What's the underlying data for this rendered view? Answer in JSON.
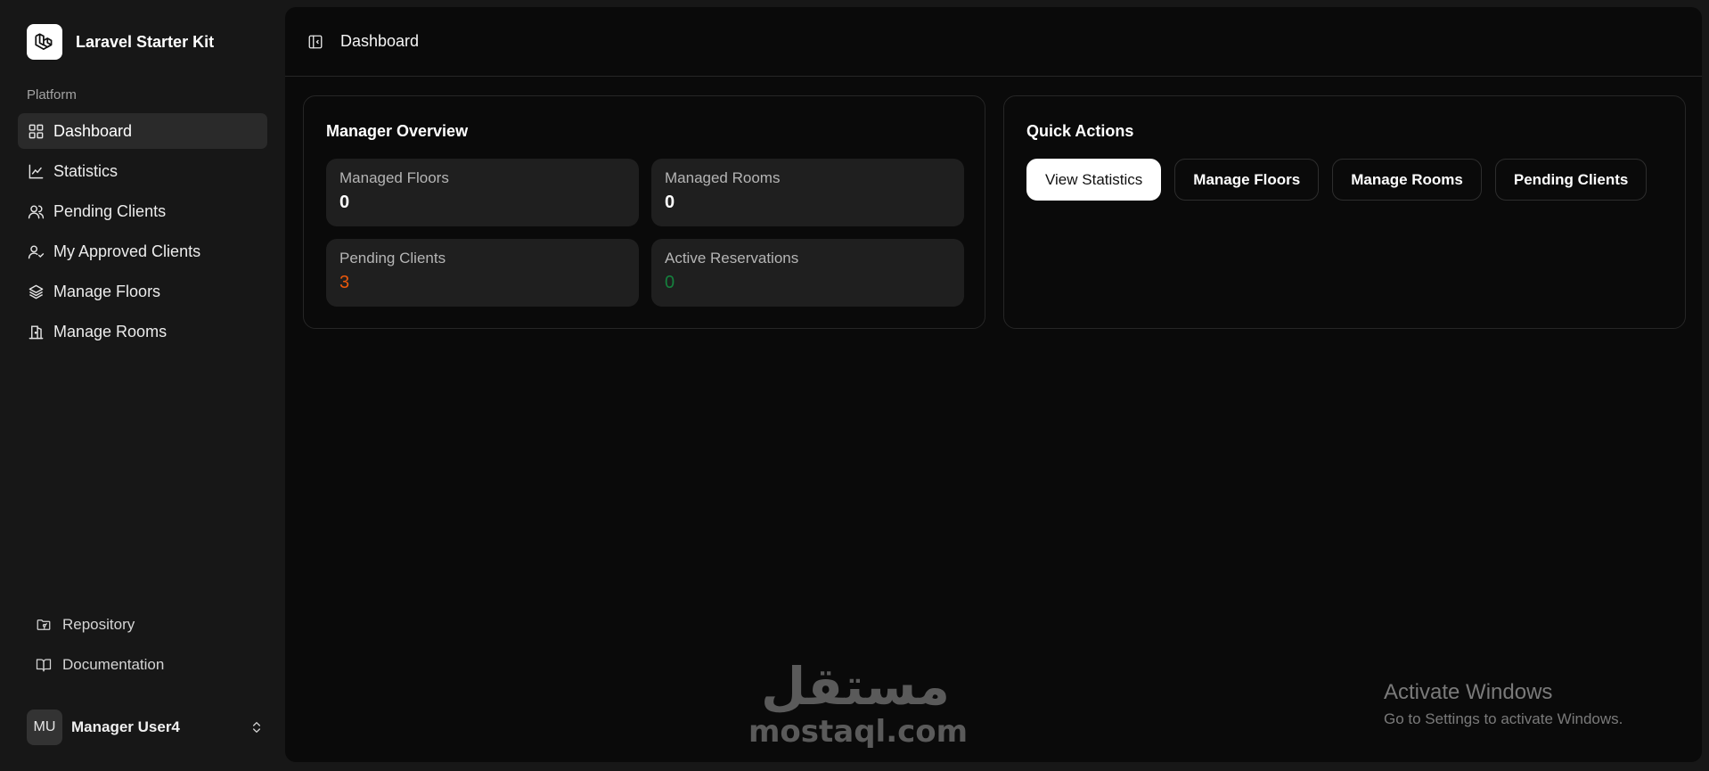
{
  "brand": {
    "title": "Laravel Starter Kit",
    "logo_icon": "laravel-logo-icon"
  },
  "sidebar": {
    "group_label": "Platform",
    "items": [
      {
        "label": "Dashboard",
        "icon": "grid-icon",
        "active": true
      },
      {
        "label": "Statistics",
        "icon": "chart-icon",
        "active": false
      },
      {
        "label": "Pending Clients",
        "icon": "users-icon",
        "active": false
      },
      {
        "label": "My Approved Clients",
        "icon": "user-check-icon",
        "active": false
      },
      {
        "label": "Manage Floors",
        "icon": "layers-icon",
        "active": false
      },
      {
        "label": "Manage Rooms",
        "icon": "door-icon",
        "active": false
      }
    ],
    "footer_links": [
      {
        "label": "Repository",
        "icon": "folder-git-icon"
      },
      {
        "label": "Documentation",
        "icon": "book-open-icon"
      }
    ],
    "user": {
      "initials": "MU",
      "name": "Manager User4"
    }
  },
  "header": {
    "breadcrumb": "Dashboard"
  },
  "overview": {
    "title": "Manager Overview",
    "stats": [
      {
        "label": "Managed Floors",
        "value": "0"
      },
      {
        "label": "Managed Rooms",
        "value": "0"
      },
      {
        "label": "Pending Clients",
        "value": "3"
      },
      {
        "label": "Active Reservations",
        "value": "0"
      }
    ]
  },
  "quick_actions": {
    "title": "Quick Actions",
    "buttons": [
      "View Statistics",
      "Manage Floors",
      "Manage Rooms",
      "Pending Clients"
    ]
  },
  "watermark": {
    "arabic": "مستقل",
    "latin": "mostaql.com"
  },
  "windows_notice": {
    "title": "Activate Windows",
    "subtitle": "Go to Settings to activate Windows."
  },
  "colors": {
    "accent_orange": "#ea580c",
    "accent_green": "#15803d",
    "background": "#0a0a0a"
  }
}
